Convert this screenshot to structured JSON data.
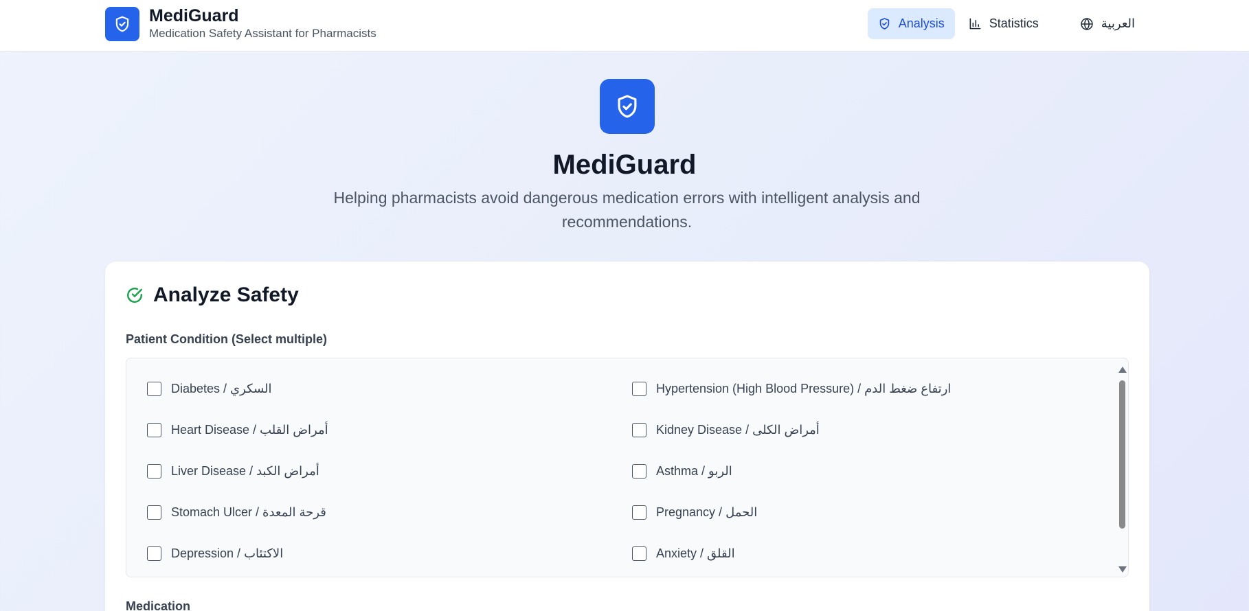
{
  "header": {
    "brand_name": "MediGuard",
    "brand_subtitle": "Medication Safety Assistant for Pharmacists",
    "brand_icon": "shield-check-icon",
    "nav": [
      {
        "label": "Analysis",
        "icon": "shield-check-icon",
        "active": true
      },
      {
        "label": "Statistics",
        "icon": "bar-chart-icon",
        "active": false
      },
      {
        "label": "العربية",
        "icon": "globe-icon",
        "active": false
      }
    ]
  },
  "hero": {
    "icon": "shield-check-icon",
    "title": "MediGuard",
    "subtitle": "Helping pharmacists avoid dangerous medication errors with intelligent analysis and recommendations."
  },
  "analyze": {
    "title": "Analyze Safety",
    "icon": "check-circle-icon",
    "conditions_label": "Patient Condition (Select multiple)",
    "conditions": [
      {
        "label": "Diabetes / السكري",
        "checked": false
      },
      {
        "label": "Hypertension (High Blood Pressure) / ارتفاع ضغط الدم",
        "checked": false
      },
      {
        "label": "Heart Disease / أمراض القلب",
        "checked": false
      },
      {
        "label": "Kidney Disease / أمراض الكلى",
        "checked": false
      },
      {
        "label": "Liver Disease / أمراض الكبد",
        "checked": false
      },
      {
        "label": "Asthma / الربو",
        "checked": false
      },
      {
        "label": "Stomach Ulcer / قرحة المعدة",
        "checked": false
      },
      {
        "label": "Pregnancy / الحمل",
        "checked": false
      },
      {
        "label": "Depression / الاكتئاب",
        "checked": false
      },
      {
        "label": "Anxiety / القلق",
        "checked": false
      }
    ],
    "medication_label": "Medication"
  },
  "colors": {
    "primary": "#2563eb",
    "active_nav_bg": "#dbeafe",
    "success": "#16a34a"
  }
}
